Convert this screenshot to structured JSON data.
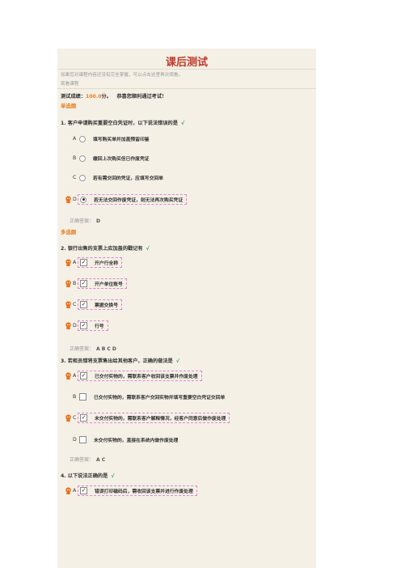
{
  "header": {
    "title": "课后测试",
    "notice": "如果您对课程内容还没有完全掌握，可以点击这里再次观看。",
    "review_link": "观看课程"
  },
  "score": {
    "label": "测试成绩：",
    "value": "100.0",
    "unit": "分。",
    "message": "恭喜您顺利通过考试！"
  },
  "sections": {
    "single": "单选题",
    "multi": "多选题"
  },
  "questions": [
    {
      "label": "1. 客户申请购买重要空白凭证时，以下说法错误的是",
      "check": "√",
      "options": [
        {
          "letter": "A",
          "text": "填写购买单并加盖预留印鉴",
          "selected": false
        },
        {
          "letter": "B",
          "text": "缴回上次购买但已作废凭证",
          "selected": false
        },
        {
          "letter": "C",
          "text": "若有需交回的凭证，应填写交回单",
          "selected": false
        },
        {
          "letter": "D",
          "text": "若无法交回作废凭证，则无法再次购买凭证",
          "selected": true
        }
      ],
      "answer_label": "正确答案：",
      "answer": "D"
    },
    {
      "label": "2. 银行出售的支票上应加盖的戳记有",
      "check": "√",
      "options": [
        {
          "letter": "A",
          "text": "开户行全称",
          "selected": true
        },
        {
          "letter": "B",
          "text": "开户单位账号",
          "selected": true
        },
        {
          "letter": "C",
          "text": "票据交换号",
          "selected": true
        },
        {
          "letter": "D",
          "text": "行号",
          "selected": true
        }
      ],
      "answer_label": "正确答案：",
      "answer": "A B C D"
    },
    {
      "label": "3. 若柜员错将支票售出给其他客户，正确的做法是",
      "check": "√",
      "options": [
        {
          "letter": "A",
          "text": "已交付实物的，需联系客户收回该支票并作废处理",
          "selected": true
        },
        {
          "letter": "B",
          "text": "已交付实物的，需联系客户交回实物并填写重要空白凭证交回单",
          "selected": false
        },
        {
          "letter": "C",
          "text": "未交付实物的，需联系客户解释情况，经客户同意后做作废处理",
          "selected": true
        },
        {
          "letter": "D",
          "text": "未交付实物的，直接在系统内做作废处理",
          "selected": false
        }
      ],
      "answer_label": "正确答案：",
      "answer": "A C"
    },
    {
      "label": "4. 以下说法正确的是",
      "check": "√",
      "options": [
        {
          "letter": "A",
          "text": "错误打印磁码后，需收回该支票并进行作废处理",
          "selected": true
        }
      ]
    }
  ],
  "colors": {
    "accent": "#e67e22",
    "title": "#c0392b",
    "check": "#2e9a3a",
    "highlight": "#e087d9",
    "panel": "#f4f0e6"
  },
  "icons": {
    "selected_marker": "orange-avatar-marker-icon"
  }
}
